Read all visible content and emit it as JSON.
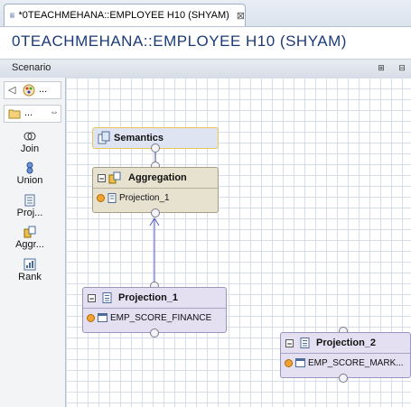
{
  "tab": {
    "title": "*0TEACHMEHANA::EMPLOYEE H10 (SHYAM)",
    "close": "⊠"
  },
  "editor": {
    "title": "0TEACHMEHANA::EMPLOYEE H10 (SHYAM)"
  },
  "scenario": {
    "label": "Scenario",
    "btn_expand": "⊞",
    "btn_collapse": "⊟"
  },
  "palette": {
    "row1_text": "...",
    "row2_text": "...",
    "items": [
      {
        "label": "Join",
        "icon": "join-icon"
      },
      {
        "label": "Union",
        "icon": "union-icon"
      },
      {
        "label": "Proj...",
        "icon": "projection-icon"
      },
      {
        "label": "Aggr...",
        "icon": "aggregation-icon"
      },
      {
        "label": "Rank",
        "icon": "rank-icon"
      }
    ]
  },
  "nodes": {
    "semantics": {
      "title": "Semantics"
    },
    "aggregation": {
      "title": "Aggregation",
      "input": "Projection_1"
    },
    "projection_1": {
      "title": "Projection_1",
      "input": "EMP_SCORE_FINANCE"
    },
    "projection_2": {
      "title": "Projection_2",
      "input": "EMP_SCORE_MARK..."
    }
  },
  "colors": {
    "semantics_fill": "#dfe4f2",
    "aggregation_fill": "#e7e1cf",
    "projection_fill": "#e4e0f2",
    "title_blue": "#1b3b78"
  }
}
